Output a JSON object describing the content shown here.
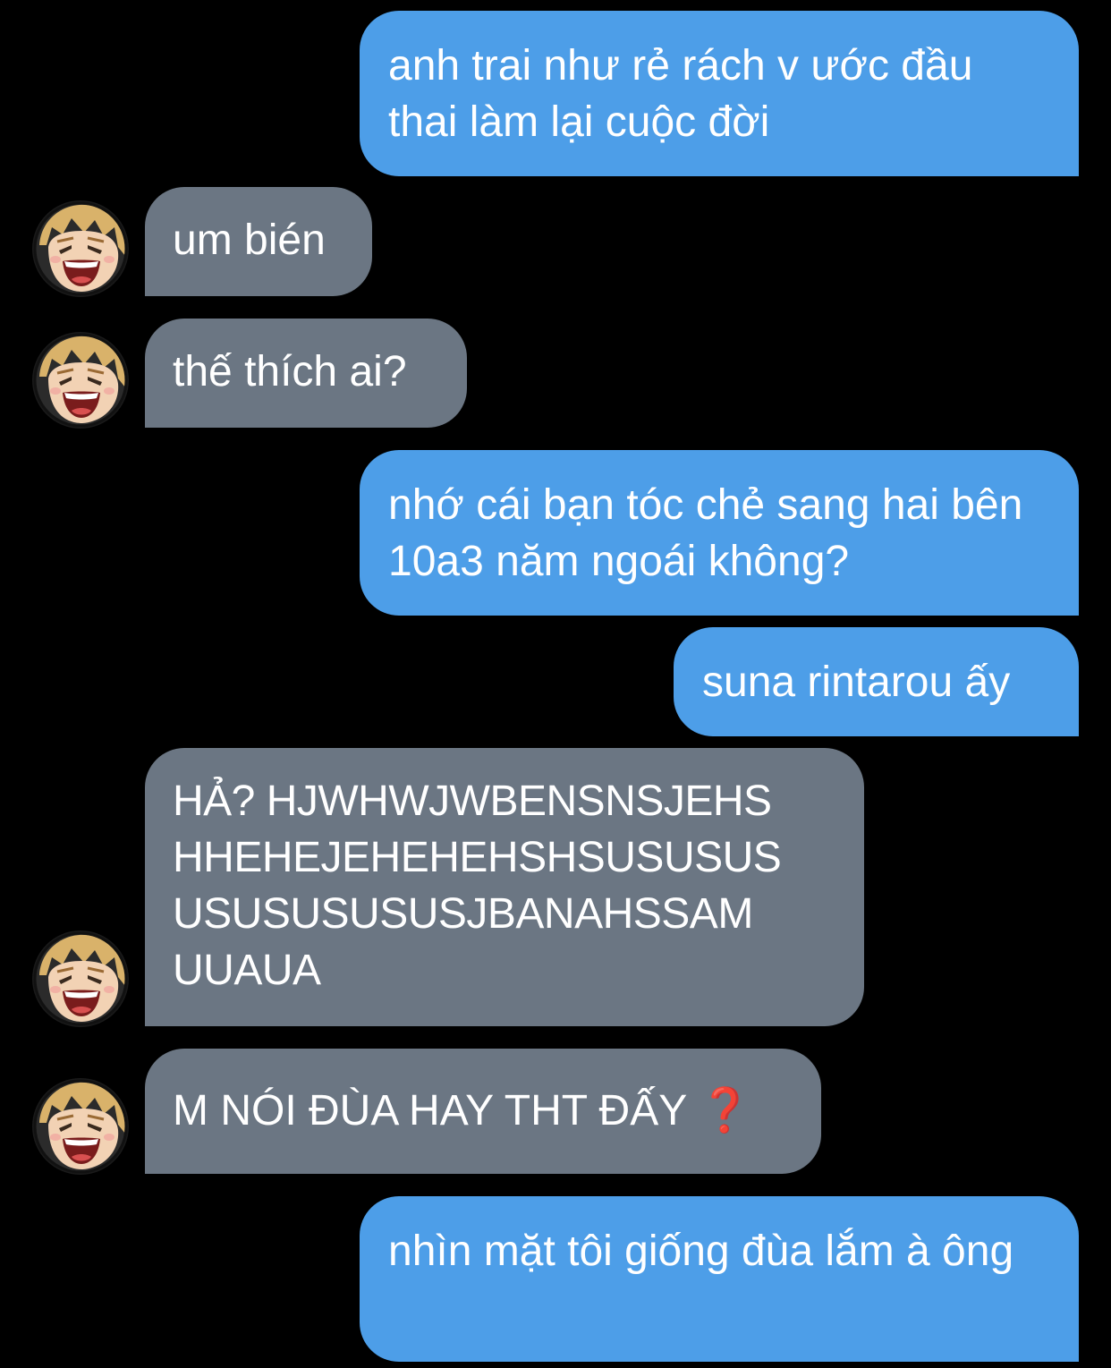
{
  "messages": [
    {
      "side": "sent",
      "text": "anh trai như rẻ rách v ước đầu thai làm lại cuộc đời"
    },
    {
      "side": "received",
      "text": "um bién"
    },
    {
      "side": "received",
      "text": "thế thích ai?"
    },
    {
      "side": "sent",
      "text": "nhớ cái bạn tóc chẻ sang hai bên 10a3 năm ngoái không?"
    },
    {
      "side": "sent",
      "text": "suna rintarou ấy"
    },
    {
      "side": "received",
      "text": "HẢ? HJWHWJWBENSNSJEHS HHEHEJEHEHEHSHSUSUSUS USUSUSUSUSJBANAHSSAM UUAUA"
    },
    {
      "side": "received",
      "text": "M NÓI ĐÙA HAY THT ĐẤY",
      "emoji": "❓"
    },
    {
      "side": "sent",
      "text": "nhìn mặt tôi giống đùa lắm à ông"
    }
  ],
  "avatar": {
    "icon": "laughing-boy-avatar-icon"
  },
  "colors": {
    "background": "#000000",
    "sent_bubble": "#4d9ee8",
    "received_bubble": "#6b7683",
    "text": "#ffffff",
    "emoji_red": "#d23a2e"
  }
}
